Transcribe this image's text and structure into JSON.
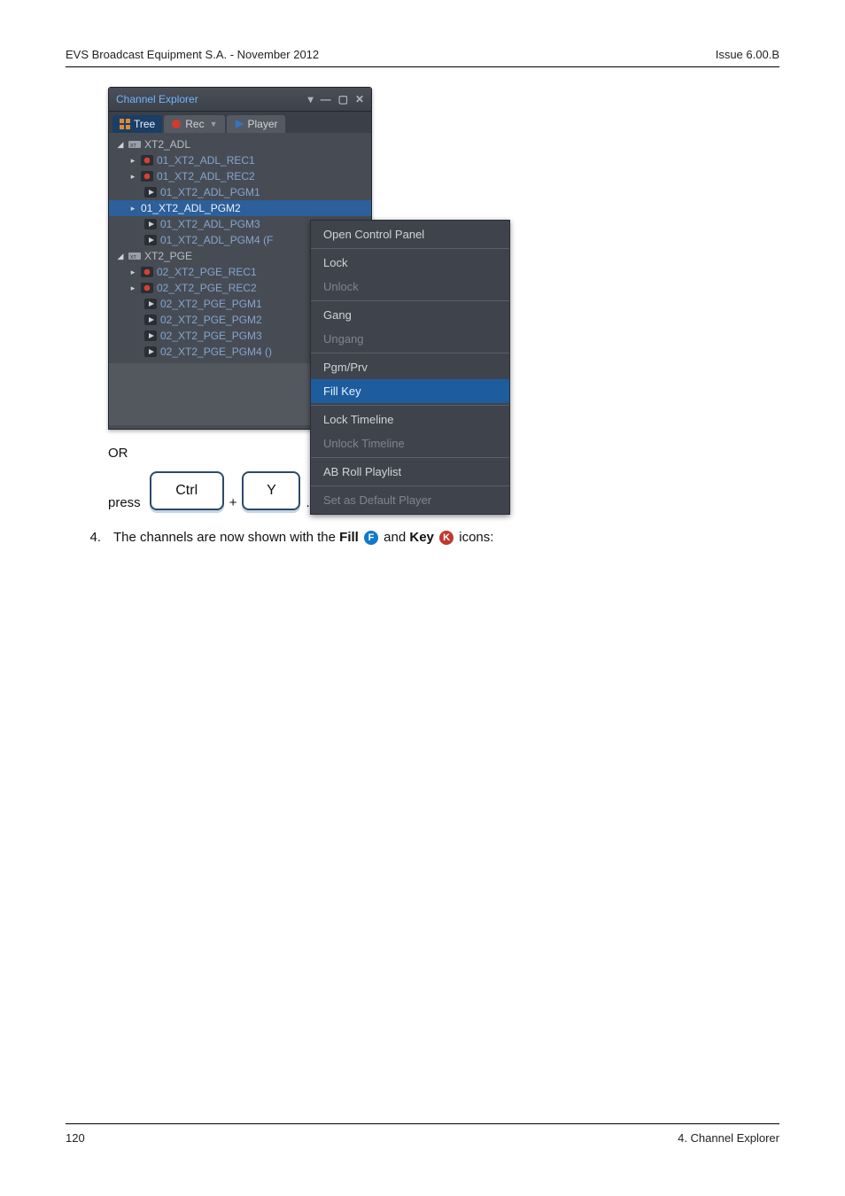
{
  "header": {
    "left": "EVS Broadcast Equipment S.A.  - November 2012",
    "right": "Issue 6.00.B"
  },
  "footer": {
    "left": "120",
    "right": "4. Channel Explorer"
  },
  "panel": {
    "title": "Channel Explorer",
    "tabs": [
      {
        "label": "Tree",
        "selected": true
      },
      {
        "label": "Rec",
        "has_dropdown": true
      },
      {
        "label": "Player"
      }
    ],
    "tree": {
      "groups": [
        {
          "label": "XT2_ADL",
          "children": [
            {
              "type": "rec",
              "label": "01_XT2_ADL_REC1"
            },
            {
              "type": "rec",
              "label": "01_XT2_ADL_REC2"
            },
            {
              "type": "play",
              "label": "01_XT2_ADL_PGM1"
            },
            {
              "type": "play",
              "label": "01_XT2_ADL_PGM2",
              "selected": true,
              "expandable": true
            },
            {
              "type": "play",
              "label": "01_XT2_ADL_PGM3"
            },
            {
              "type": "play",
              "label": "01_XT2_ADL_PGM4 (F"
            }
          ]
        },
        {
          "label": "XT2_PGE",
          "children": [
            {
              "type": "rec",
              "label": "02_XT2_PGE_REC1"
            },
            {
              "type": "rec",
              "label": "02_XT2_PGE_REC2"
            },
            {
              "type": "play",
              "label": "02_XT2_PGE_PGM1"
            },
            {
              "type": "play",
              "label": "02_XT2_PGE_PGM2"
            },
            {
              "type": "play",
              "label": "02_XT2_PGE_PGM3"
            },
            {
              "type": "play",
              "label": "02_XT2_PGE_PGM4 ()"
            }
          ]
        }
      ]
    }
  },
  "context_menu": [
    {
      "label": "Open Control Panel"
    },
    {
      "sep": true
    },
    {
      "label": "Lock"
    },
    {
      "label": "Unlock",
      "disabled": true
    },
    {
      "sep": true
    },
    {
      "label": "Gang"
    },
    {
      "label": "Ungang",
      "disabled": true
    },
    {
      "sep": true
    },
    {
      "label": "Pgm/Prv"
    },
    {
      "label": "Fill Key",
      "selected": true
    },
    {
      "sep": true
    },
    {
      "label": "Lock Timeline"
    },
    {
      "label": "Unlock Timeline",
      "disabled": true
    },
    {
      "sep": true
    },
    {
      "label": "AB Roll Playlist"
    },
    {
      "sep": true
    },
    {
      "label": "Set as Default Player",
      "disabled": true
    }
  ],
  "or_label": "OR",
  "keys": {
    "press": "press",
    "k1": "Ctrl",
    "plus": "+",
    "k2": "Y",
    "end": "."
  },
  "step4": {
    "num": "4.",
    "pre": "The channels are now shown with the ",
    "fill": "Fill",
    "and": " and ",
    "key": "Key",
    "post": " icons:"
  }
}
